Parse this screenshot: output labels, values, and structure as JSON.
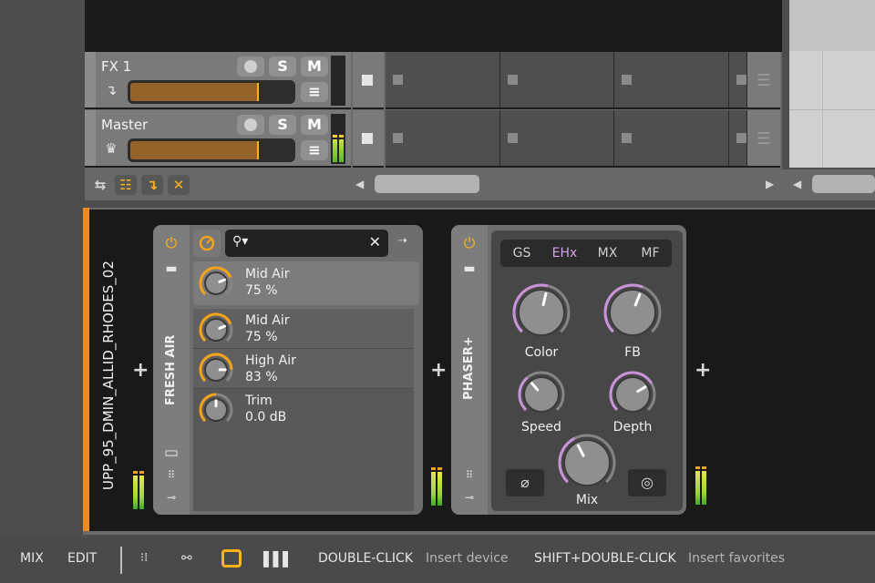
{
  "tracks": [
    {
      "name": "FX 1",
      "icon": "send-arrow-icon",
      "volume_fraction": 0.78,
      "record_label": "",
      "solo_label": "S",
      "mute_label": "M",
      "menu_label": "≡",
      "meter_level": 0
    },
    {
      "name": "Master",
      "icon": "crown-icon",
      "volume_fraction": 0.78,
      "record_label": "",
      "solo_label": "S",
      "mute_label": "M",
      "menu_label": "≡",
      "meter_level": 0.55
    }
  ],
  "arranger_toolbar": {
    "buttons": [
      {
        "name": "swap-icon",
        "glyph": "⇆",
        "active": false
      },
      {
        "name": "clip-launcher-icon",
        "glyph": "☷",
        "active": true
      },
      {
        "name": "return-arrow-icon",
        "glyph": "↴",
        "active": true
      },
      {
        "name": "close-icon",
        "glyph": "✕",
        "active": true
      }
    ],
    "scroll_left": "◀",
    "scroll_right": "▶"
  },
  "device_chain": {
    "track_name": "UPP_95_DMIN_ALLID_RHODES_02",
    "accent_color": "#f08a22",
    "devices": [
      {
        "name": "FRESH AIR",
        "search_placeholder": "",
        "search_clear": "✕",
        "search_arrow": "➝",
        "header_param": {
          "label": "Mid Air",
          "value": "75 %",
          "fraction": 0.75
        },
        "params": [
          {
            "label": "Mid Air",
            "value": "75 %",
            "fraction": 0.75
          },
          {
            "label": "High Air",
            "value": "83 %",
            "fraction": 0.83
          },
          {
            "label": "Trim",
            "value": "0.0 dB",
            "fraction": 0.5
          }
        ],
        "knob_color": "#f5a31a"
      },
      {
        "name": "PHASER+",
        "tabs": [
          {
            "label": "GS",
            "active": false
          },
          {
            "label": "EHx",
            "active": true
          },
          {
            "label": "MX",
            "active": false
          },
          {
            "label": "MF",
            "active": false
          }
        ],
        "knobs": [
          {
            "label": "Color",
            "fraction": 0.55
          },
          {
            "label": "FB",
            "fraction": 0.58
          },
          {
            "label": "Speed",
            "fraction": 0.35
          },
          {
            "label": "Depth",
            "fraction": 0.72
          },
          {
            "label": "Mix",
            "fraction": 0.4
          }
        ],
        "phase_button": "⌀",
        "stereo_button": "◎",
        "knob_color": "#c992d9"
      }
    ]
  },
  "statusbar": {
    "mix": "MIX",
    "edit": "EDIT",
    "hint1_key": "DOUBLE-CLICK",
    "hint1_text": "Insert device",
    "hint2_key": "SHIFT+DOUBLE-CLICK",
    "hint2_text": "Insert favorites",
    "accent": "#ffb31a"
  }
}
